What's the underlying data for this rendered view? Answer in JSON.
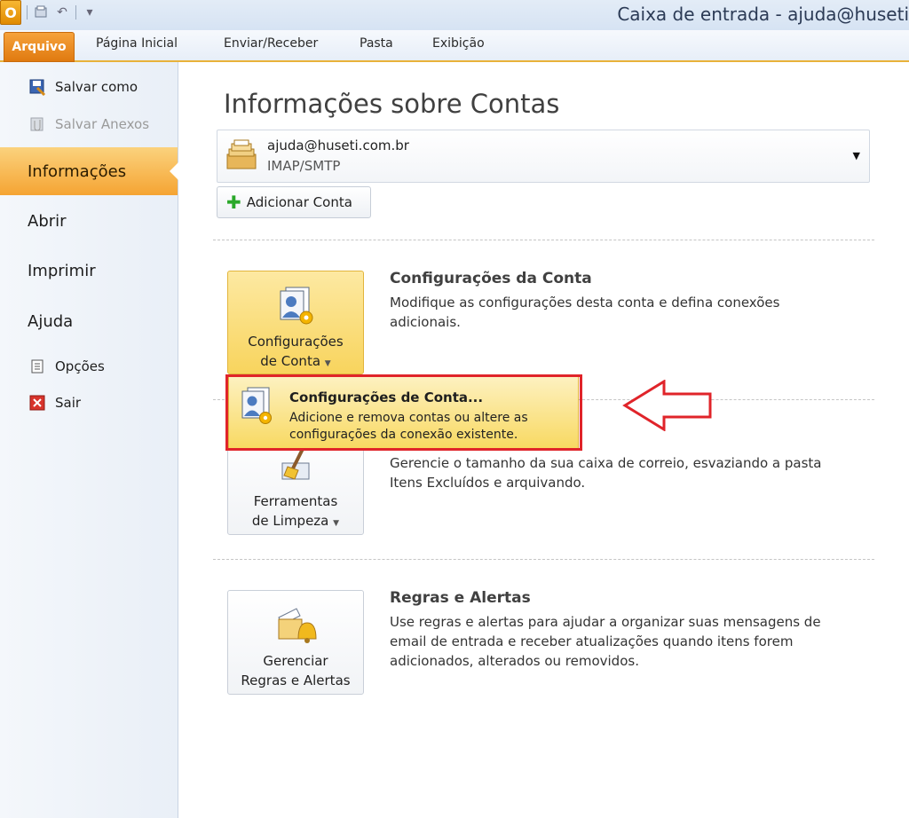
{
  "window": {
    "title": "Caixa de entrada - ajuda@huseti",
    "app_icon_letter": "O"
  },
  "ribbon": {
    "tabs": [
      "Arquivo",
      "Página Inicial",
      "Enviar/Receber",
      "Pasta",
      "Exibição"
    ]
  },
  "leftnav": {
    "commands": [
      {
        "label": "Salvar como",
        "icon": "save-as-icon",
        "enabled": true
      },
      {
        "label": "Salvar Anexos",
        "icon": "save-attachments-icon",
        "enabled": false
      }
    ],
    "items": [
      {
        "label": "Informações",
        "active": true
      },
      {
        "label": "Abrir",
        "active": false
      },
      {
        "label": "Imprimir",
        "active": false
      },
      {
        "label": "Ajuda",
        "active": false
      }
    ],
    "bottom_commands": [
      {
        "label": "Opções",
        "icon": "options-icon"
      },
      {
        "label": "Sair",
        "icon": "exit-icon"
      }
    ]
  },
  "main": {
    "heading": "Informações sobre Contas",
    "account": {
      "email": "ajuda@huseti.com.br",
      "type": "IMAP/SMTP"
    },
    "add_account_label": "Adicionar Conta",
    "sections": [
      {
        "button_line1": "Configurações",
        "button_line2": "de Conta",
        "title": "Configurações da Conta",
        "description": "Modifique as configurações desta conta e defina conexões adicionais."
      },
      {
        "button_line1": "Ferramentas",
        "button_line2": "de Limpeza",
        "title": "",
        "description": "Gerencie o tamanho da sua caixa de correio, esvaziando a pasta Itens Excluídos e arquivando."
      },
      {
        "button_line1": "Gerenciar",
        "button_line2": "Regras e Alertas",
        "title": "Regras e Alertas",
        "description": "Use regras e alertas para ajudar a organizar suas mensagens de email de entrada e receber atualizações quando itens forem adicionados, alterados ou removidos."
      }
    ],
    "dropdown": {
      "title": "Configurações de Conta...",
      "description": "Adicione e remova contas ou altere as configurações da conexão existente."
    }
  },
  "colors": {
    "accent_orange": "#f5a433",
    "highlight_red": "#e0242a",
    "popup_yellow": "#f8d962"
  }
}
